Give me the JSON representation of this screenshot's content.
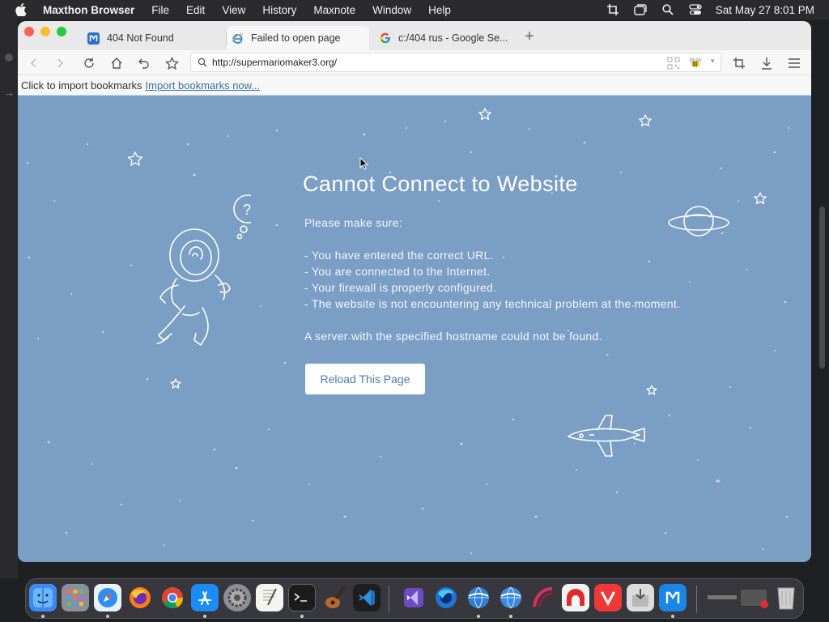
{
  "menubar": {
    "app_name": "Maxthon Browser",
    "menus": [
      "File",
      "Edit",
      "View",
      "History",
      "Maxnote",
      "Window",
      "Help"
    ],
    "clock": "Sat May 27  8:01 PM",
    "status_icons": [
      "crop-icon",
      "window-icon",
      "search-icon",
      "control-center-icon"
    ]
  },
  "tabs": [
    {
      "label": "404 Not Found",
      "favicon": "maxthon-icon",
      "active": false
    },
    {
      "label": "Failed to open page",
      "favicon": "ie-icon",
      "active": true
    },
    {
      "label": "c:/404 rus - Google Se...",
      "favicon": "google-icon",
      "active": false
    }
  ],
  "new_tab_label": "+",
  "address": {
    "url": "http://supermariomaker3.org/"
  },
  "bookmarkbar": {
    "prompt": "Click to import bookmarks",
    "link": "Import bookmarks now..."
  },
  "error": {
    "title": "Cannot Connect to Website",
    "intro": "Please make sure:",
    "checks": [
      "- You have entered the correct URL.",
      "- You are connected to the Internet.",
      "- Your firewall is properly configured.",
      "- The website is not encountering any technical problem at the moment."
    ],
    "detail": "A server with the specified hostname could not be found.",
    "reload_label": "Reload This Page"
  },
  "colors": {
    "page_bg": "#7b9ec5",
    "button_text": "#4d7aab",
    "link": "#3a6ea5"
  },
  "dock": {
    "icons": [
      "finder-icon",
      "launchpad-icon",
      "safari-icon",
      "firefox-icon",
      "chrome-icon",
      "app-store-icon",
      "system-preferences-icon",
      "textedit-icon",
      "terminal-icon",
      "garageband-icon",
      "vscode-icon",
      "visual-studio-icon",
      "firefox-developer-icon",
      "browser-globe-icon",
      "browser-globe-icon-2",
      "arc-browser-icon",
      "red-app-icon",
      "vivaldi-icon",
      "installer-icon",
      "maxthon-icon",
      "minimized-window-icon",
      "minimized-window-icon-2",
      "trash-icon"
    ]
  }
}
